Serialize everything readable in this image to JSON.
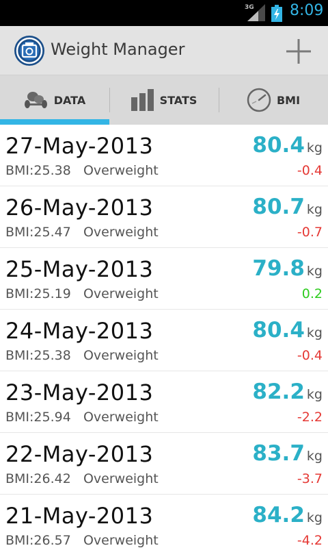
{
  "status_bar": {
    "network": "3G",
    "time": "8:09",
    "icons": [
      "signal-icon",
      "battery-charging-icon"
    ],
    "time_color": "#33b5e5"
  },
  "action_bar": {
    "app_icon": "scale-app-icon",
    "title": "Weight Manager",
    "add_icon": "plus-icon"
  },
  "tabs": [
    {
      "label": "DATA",
      "icon": "dumbbell-icon",
      "selected": true
    },
    {
      "label": "STATS",
      "icon": "bar-chart-icon",
      "selected": false
    },
    {
      "label": "BMI",
      "icon": "gauge-icon",
      "selected": false
    }
  ],
  "colors": {
    "accent": "#33b5e5",
    "weight": "#2bb0c7",
    "decrease": "#e53935",
    "increase": "#2ecc1f"
  },
  "entries": [
    {
      "date": "27-May-2013",
      "bmi": "BMI:25.38",
      "status": "Overweight",
      "weight": "80.4",
      "unit": "kg",
      "diff": "-0.4",
      "trend": "down"
    },
    {
      "date": "26-May-2013",
      "bmi": "BMI:25.47",
      "status": "Overweight",
      "weight": "80.7",
      "unit": "kg",
      "diff": "-0.7",
      "trend": "down"
    },
    {
      "date": "25-May-2013",
      "bmi": "BMI:25.19",
      "status": "Overweight",
      "weight": "79.8",
      "unit": "kg",
      "diff": "0.2",
      "trend": "up"
    },
    {
      "date": "24-May-2013",
      "bmi": "BMI:25.38",
      "status": "Overweight",
      "weight": "80.4",
      "unit": "kg",
      "diff": "-0.4",
      "trend": "down"
    },
    {
      "date": "23-May-2013",
      "bmi": "BMI:25.94",
      "status": "Overweight",
      "weight": "82.2",
      "unit": "kg",
      "diff": "-2.2",
      "trend": "down"
    },
    {
      "date": "22-May-2013",
      "bmi": "BMI:26.42",
      "status": "Overweight",
      "weight": "83.7",
      "unit": "kg",
      "diff": "-3.7",
      "trend": "down"
    },
    {
      "date": "21-May-2013",
      "bmi": "BMI:26.57",
      "status": "Overweight",
      "weight": "84.2",
      "unit": "kg",
      "diff": "-4.2",
      "trend": "down"
    }
  ]
}
